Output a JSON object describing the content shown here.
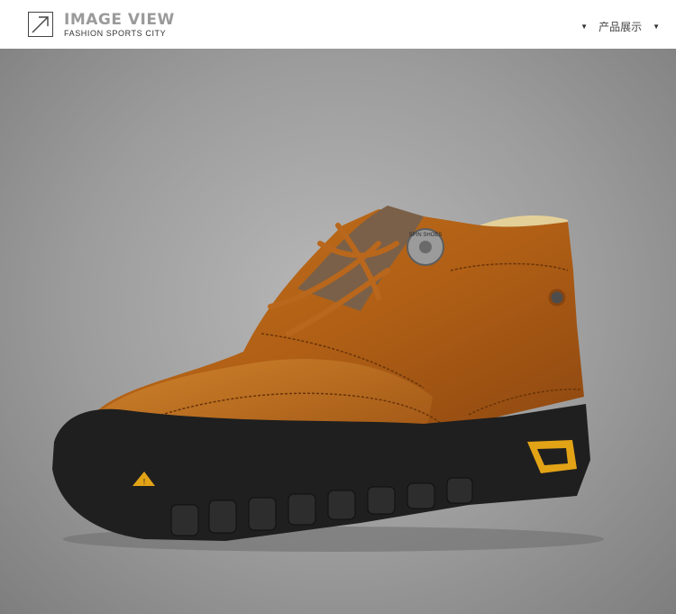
{
  "header": {
    "title": "IMAGE VIEW",
    "subtitle": "FASHION SPORTS CITY",
    "nav_label": "产品展示",
    "nav_left_icon": "triangle-down-icon",
    "nav_right_icon": "triangle-down-icon"
  },
  "photo": {
    "subject": "product-photo",
    "eyelet_text": "SPIN  SHOES"
  }
}
